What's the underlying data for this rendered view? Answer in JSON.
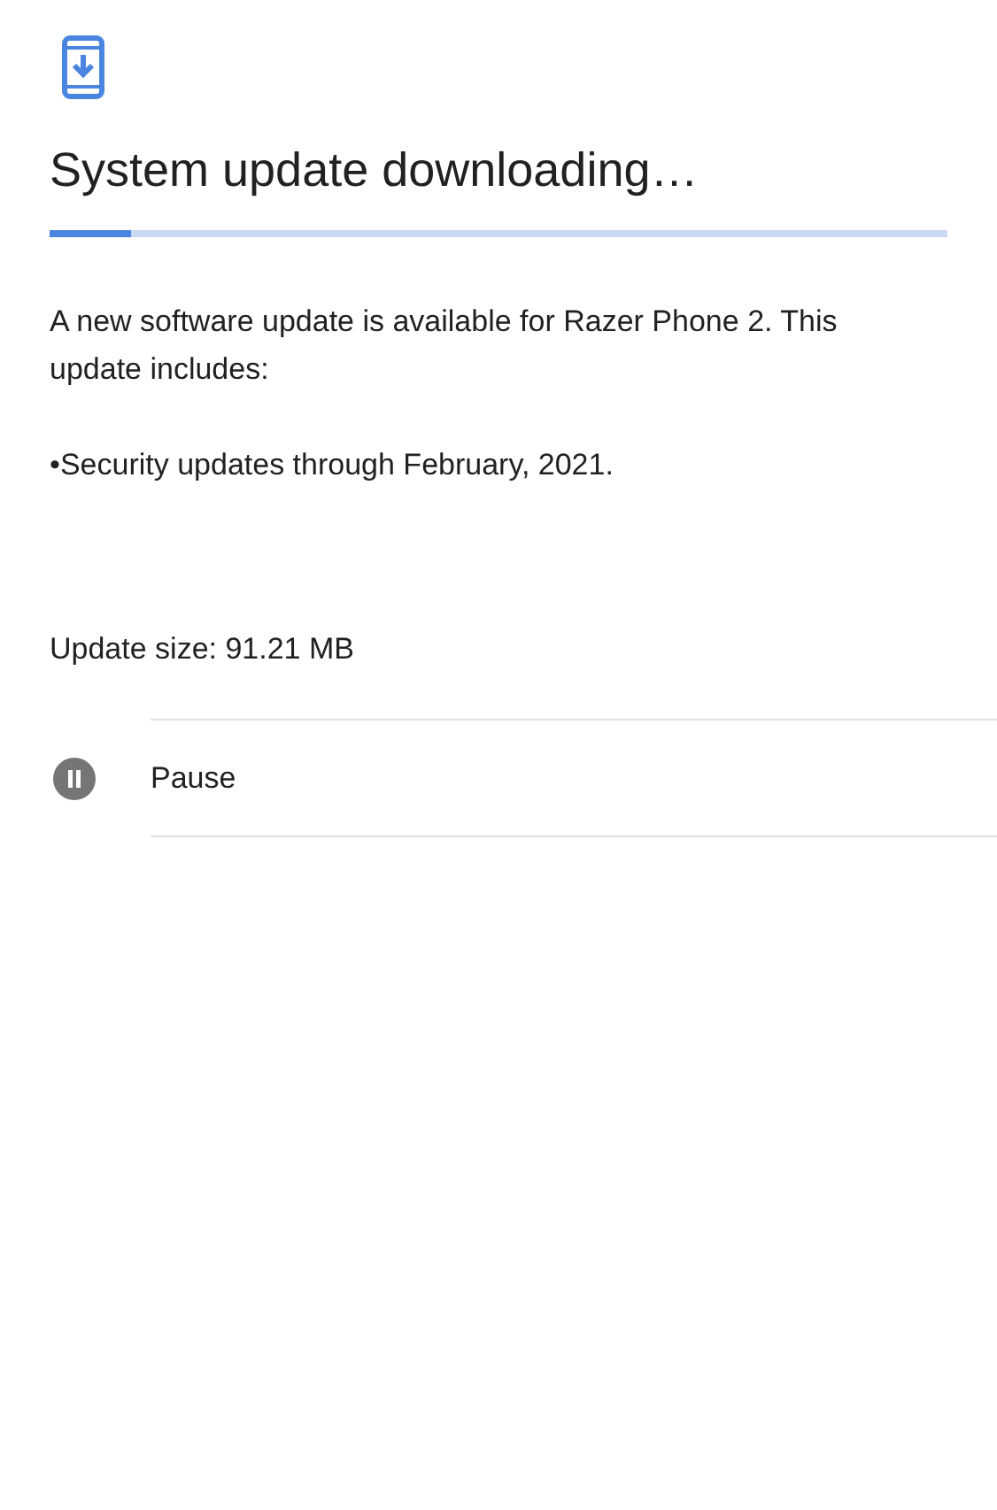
{
  "title": "System update downloading…",
  "progress": {
    "level": 0.09
  },
  "description": "A new software update is available for Razer Phone 2. This update includes:",
  "bullets": [
    "•Security updates through February, 2021."
  ],
  "update_size": "Update size: 91.21 MB",
  "actions": [
    {
      "kind": "pause",
      "label": "Pause"
    }
  ]
}
